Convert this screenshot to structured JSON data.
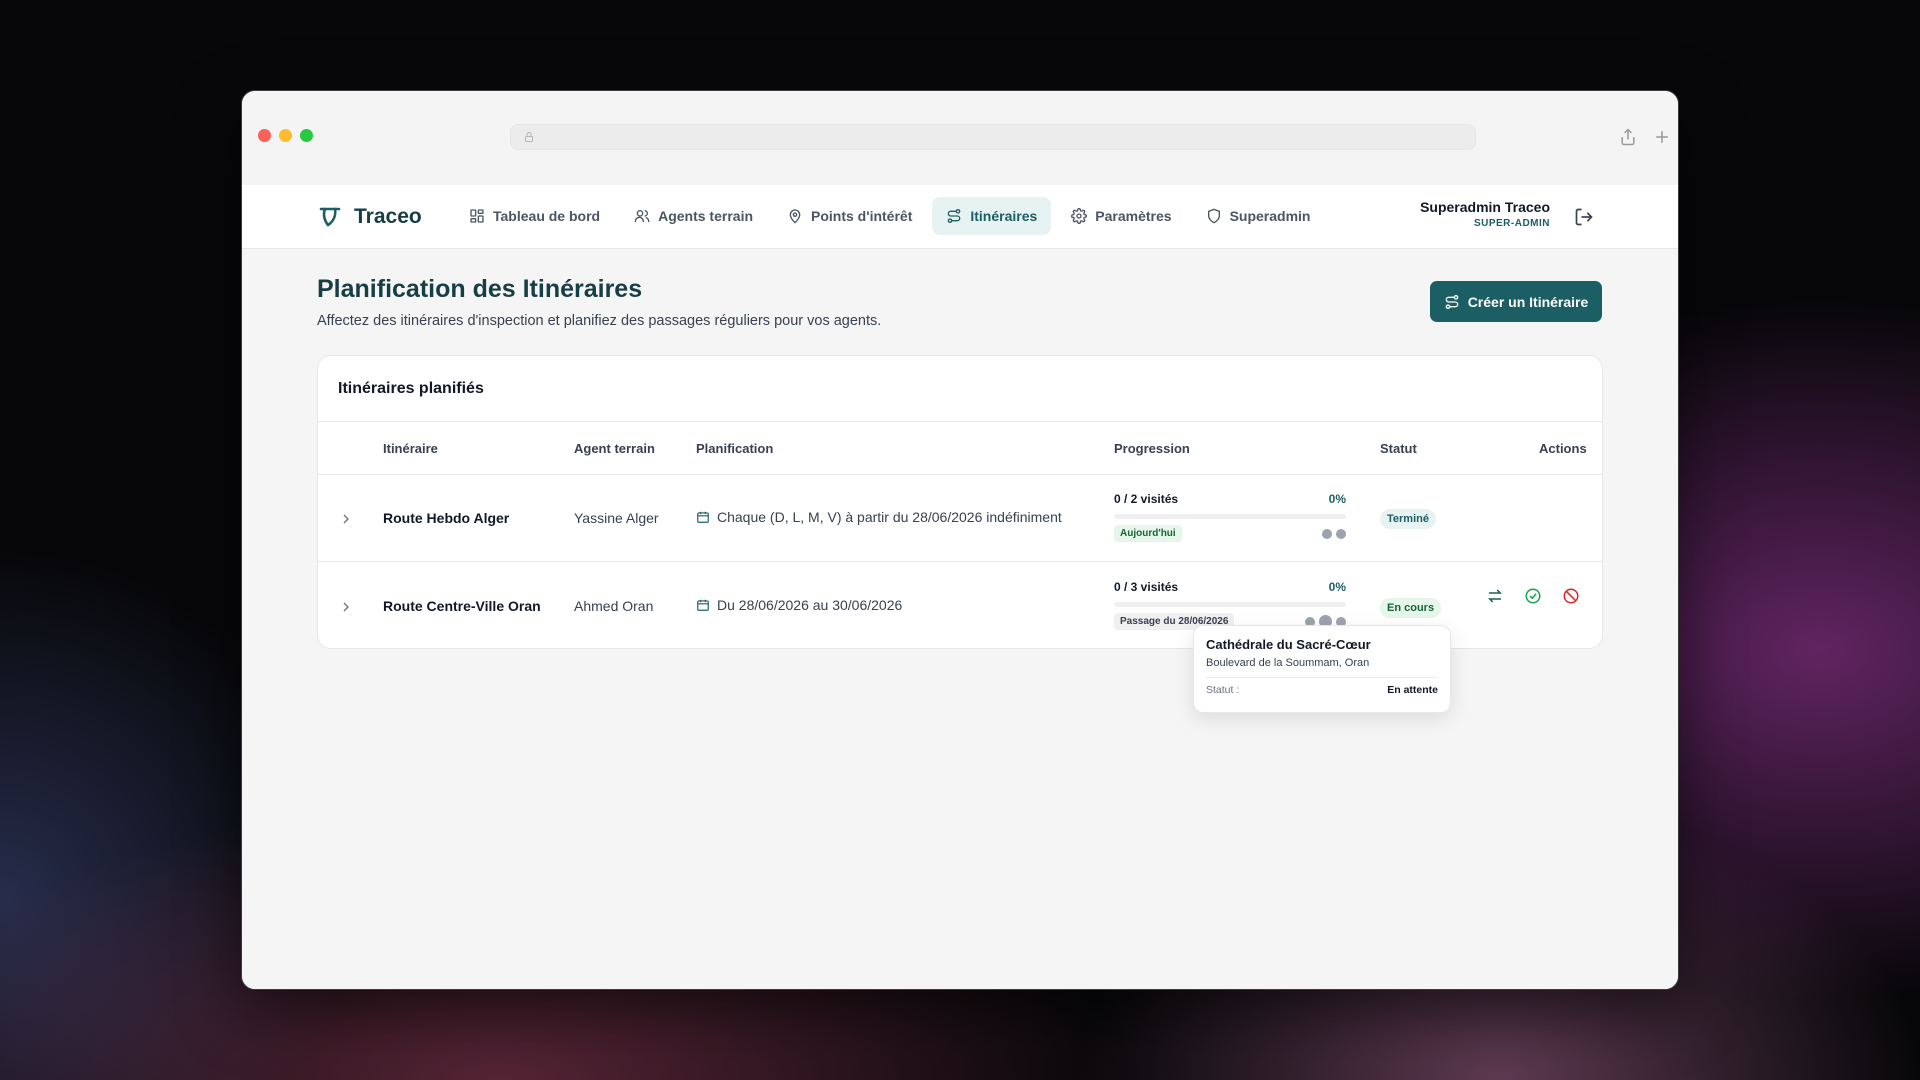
{
  "brand": {
    "name": "Traceo"
  },
  "nav": {
    "items": [
      {
        "label": "Tableau de bord",
        "icon": "grid-icon"
      },
      {
        "label": "Agents terrain",
        "icon": "users-icon"
      },
      {
        "label": "Points d'intérêt",
        "icon": "map-pin-icon"
      },
      {
        "label": "Itinéraires",
        "icon": "route-icon",
        "active": true
      },
      {
        "label": "Paramètres",
        "icon": "gear-icon"
      },
      {
        "label": "Superadmin",
        "icon": "shield-icon"
      }
    ]
  },
  "user": {
    "name": "Superadmin Traceo",
    "role": "SUPER-ADMIN"
  },
  "page": {
    "title": "Planification des Itinéraires",
    "subtitle": "Affectez des itinéraires d'inspection et planifiez des passages réguliers pour vos agents.",
    "create_button": "Créer un Itinéraire"
  },
  "table": {
    "title": "Itinéraires planifiés",
    "columns": [
      "Itinéraire",
      "Agent terrain",
      "Planification",
      "Progression",
      "Statut",
      "Actions"
    ],
    "rows": [
      {
        "name": "Route Hebdo Alger",
        "agent": "Yassine Alger",
        "planning": "Chaque (D, L, M, V) à partir du 28/06/2026 indéfiniment",
        "progress_text": "0 / 2 visités",
        "progress_pct": "0%",
        "progress_value": 0,
        "pill": "Aujourd'hui",
        "status": "Terminé"
      },
      {
        "name": "Route Centre-Ville Oran",
        "agent": "Ahmed Oran",
        "planning": "Du 28/06/2026 au 30/06/2026",
        "progress_text": "0 / 3 visités",
        "progress_pct": "0%",
        "progress_value": 0,
        "pill": "Passage du 28/06/2026",
        "status": "En cours"
      }
    ]
  },
  "tooltip": {
    "title": "Cathédrale du Sacré-Cœur",
    "address": "Boulevard de la Soummam, Oran",
    "status_label": "Statut :",
    "status_value": "En attente"
  },
  "colors": {
    "primary": "#1b5e63",
    "active_nav_bg": "#e7f2f2",
    "success": "#16a34a",
    "danger": "#dc2626"
  }
}
